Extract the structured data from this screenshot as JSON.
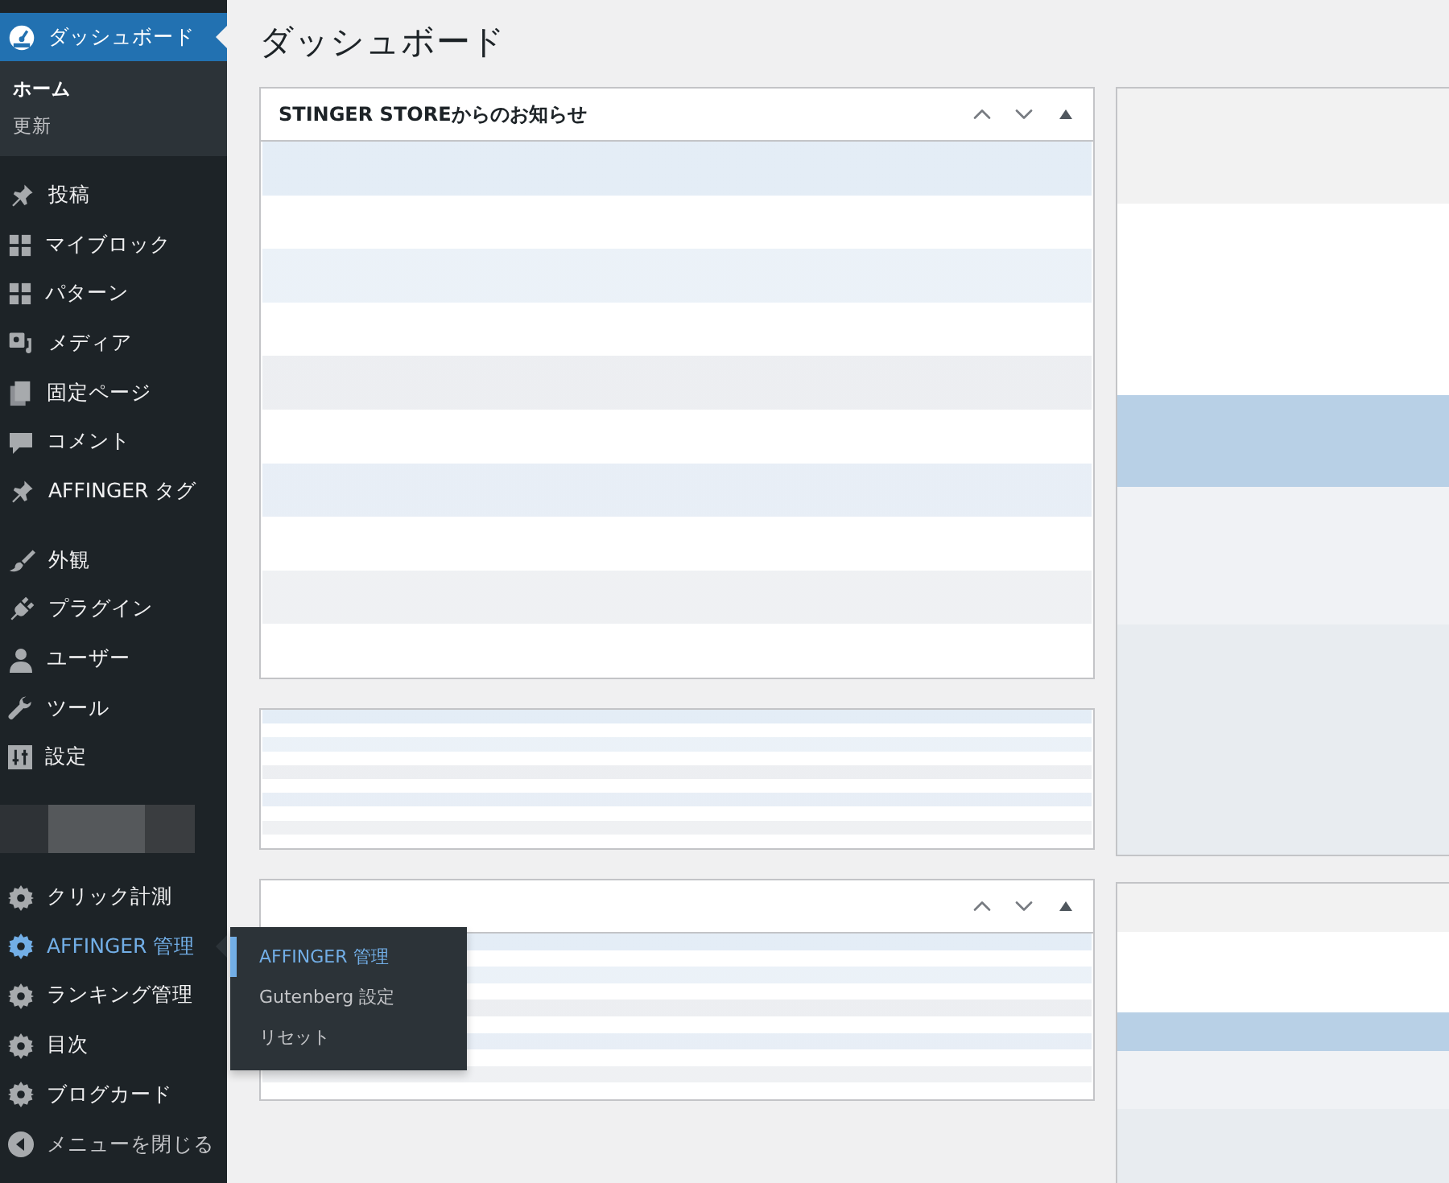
{
  "sidebar": {
    "dashboard": {
      "label": "ダッシュボード",
      "selected": true
    },
    "submenu": [
      {
        "label": "ホーム",
        "selected": true
      },
      {
        "label": "更新",
        "selected": false
      }
    ],
    "groups": [
      [
        {
          "kind": "item",
          "label": "投稿",
          "hover": false
        },
        {
          "kind": "item",
          "label": "マイブロック",
          "hover": false
        },
        {
          "kind": "item",
          "label": "パターン",
          "hover": false
        },
        {
          "kind": "item",
          "label": "メディア",
          "hover": false
        },
        {
          "kind": "item",
          "label": "固定ページ",
          "hover": false
        },
        {
          "kind": "item",
          "label": "コメント",
          "hover": false
        },
        {
          "kind": "item",
          "label": "AFFINGER タグ",
          "hover": false
        }
      ],
      [
        {
          "kind": "item",
          "label": "外観",
          "hover": false
        },
        {
          "kind": "item",
          "label": "プラグイン",
          "hover": false
        },
        {
          "kind": "item",
          "label": "ユーザー",
          "hover": false
        },
        {
          "kind": "item",
          "label": "ツール",
          "hover": false
        },
        {
          "kind": "item",
          "label": "設定",
          "hover": false
        }
      ],
      [
        {
          "kind": "blurred"
        },
        {
          "kind": "item",
          "label": "クリック計測",
          "hover": false
        },
        {
          "kind": "item",
          "label": "AFFINGER 管理",
          "hover": true
        },
        {
          "kind": "item",
          "label": "ランキング管理",
          "hover": false
        },
        {
          "kind": "item",
          "label": "目次",
          "hover": false
        },
        {
          "kind": "item",
          "label": "ブログカード",
          "hover": false
        },
        {
          "kind": "collapse",
          "label": "メニューを閉じる",
          "hover": false
        }
      ]
    ],
    "flyout": [
      {
        "label": "AFFINGER 管理",
        "selected": true
      },
      {
        "label": "Gutenberg 設定",
        "selected": false
      },
      {
        "label": "リセット",
        "selected": false
      }
    ]
  },
  "page_title": "ダッシュボード",
  "panels": [
    {
      "title": "STINGER STOREからのお知らせ",
      "controls": true
    },
    {
      "controls": false
    },
    {
      "controls": true
    }
  ]
}
